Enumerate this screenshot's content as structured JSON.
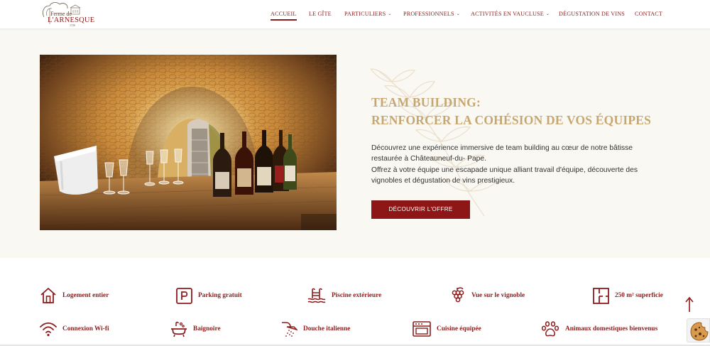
{
  "header": {
    "logo": {
      "line1": "Ferme de",
      "line2": "L'ARNESQUE"
    },
    "nav": [
      {
        "label": "ACCUEIL",
        "active": true,
        "has_dropdown": false
      },
      {
        "label": "LE GÎTE",
        "active": false,
        "has_dropdown": false
      },
      {
        "label": "PARTICULIERS",
        "active": false,
        "has_dropdown": true
      },
      {
        "label": "PROFESSIONNELS",
        "active": false,
        "has_dropdown": true
      },
      {
        "label": "ACTIVITÉS EN VAUCLUSE",
        "active": false,
        "has_dropdown": true
      },
      {
        "label": "DÉGUSTATION DE VINS",
        "active": false,
        "has_dropdown": false
      },
      {
        "label": "CONTACT",
        "active": false,
        "has_dropdown": false
      }
    ],
    "dropdown_glyph": "⌄"
  },
  "hero": {
    "title_line1": "TEAM BUILDING:",
    "title_line2": "RENFORCER LA COHÉSION DE VOS ÉQUIPES",
    "paragraph1": "Découvrez une expérience immersive de team building au cœur de notre bâtisse restaurée à Châteauneuf-du- Pape.",
    "paragraph2": "Offrez à votre équipe une escapade unique alliant travail d'équipe, découverte des vignobles et dégustation de vins prestigieux.",
    "cta_label": "DÉCOUVRIR L'OFFRE",
    "image_description_icon": "wine-cellar-photo"
  },
  "amenities": [
    {
      "label": "Logement entier",
      "icon": "house-icon"
    },
    {
      "label": "Parking gratuit",
      "icon": "parking-icon"
    },
    {
      "label": "Piscine extérieure",
      "icon": "pool-icon"
    },
    {
      "label": "Vue sur le vignoble",
      "icon": "grapes-icon"
    },
    {
      "label": "250 m² superficie",
      "icon": "floorplan-icon"
    },
    {
      "label": "Connexion Wi-fi",
      "icon": "wifi-icon"
    },
    {
      "label": "Baignoire",
      "icon": "bathtub-icon"
    },
    {
      "label": "Douche italienne",
      "icon": "shower-icon"
    },
    {
      "label": "Cuisine équipée",
      "icon": "oven-icon"
    },
    {
      "label": "Animaux domestiques bienvenus",
      "icon": "paw-icon"
    }
  ],
  "widgets": {
    "scroll_top_glyph": "↑",
    "scroll_top_icon": "arrow-up-icon",
    "cookie_icon": "cookie-icon"
  },
  "colors": {
    "brand_red": "#8d1c1c",
    "gold": "#c6a772",
    "hero_bg": "#faf8f2",
    "cta_bg": "#8d1616"
  }
}
